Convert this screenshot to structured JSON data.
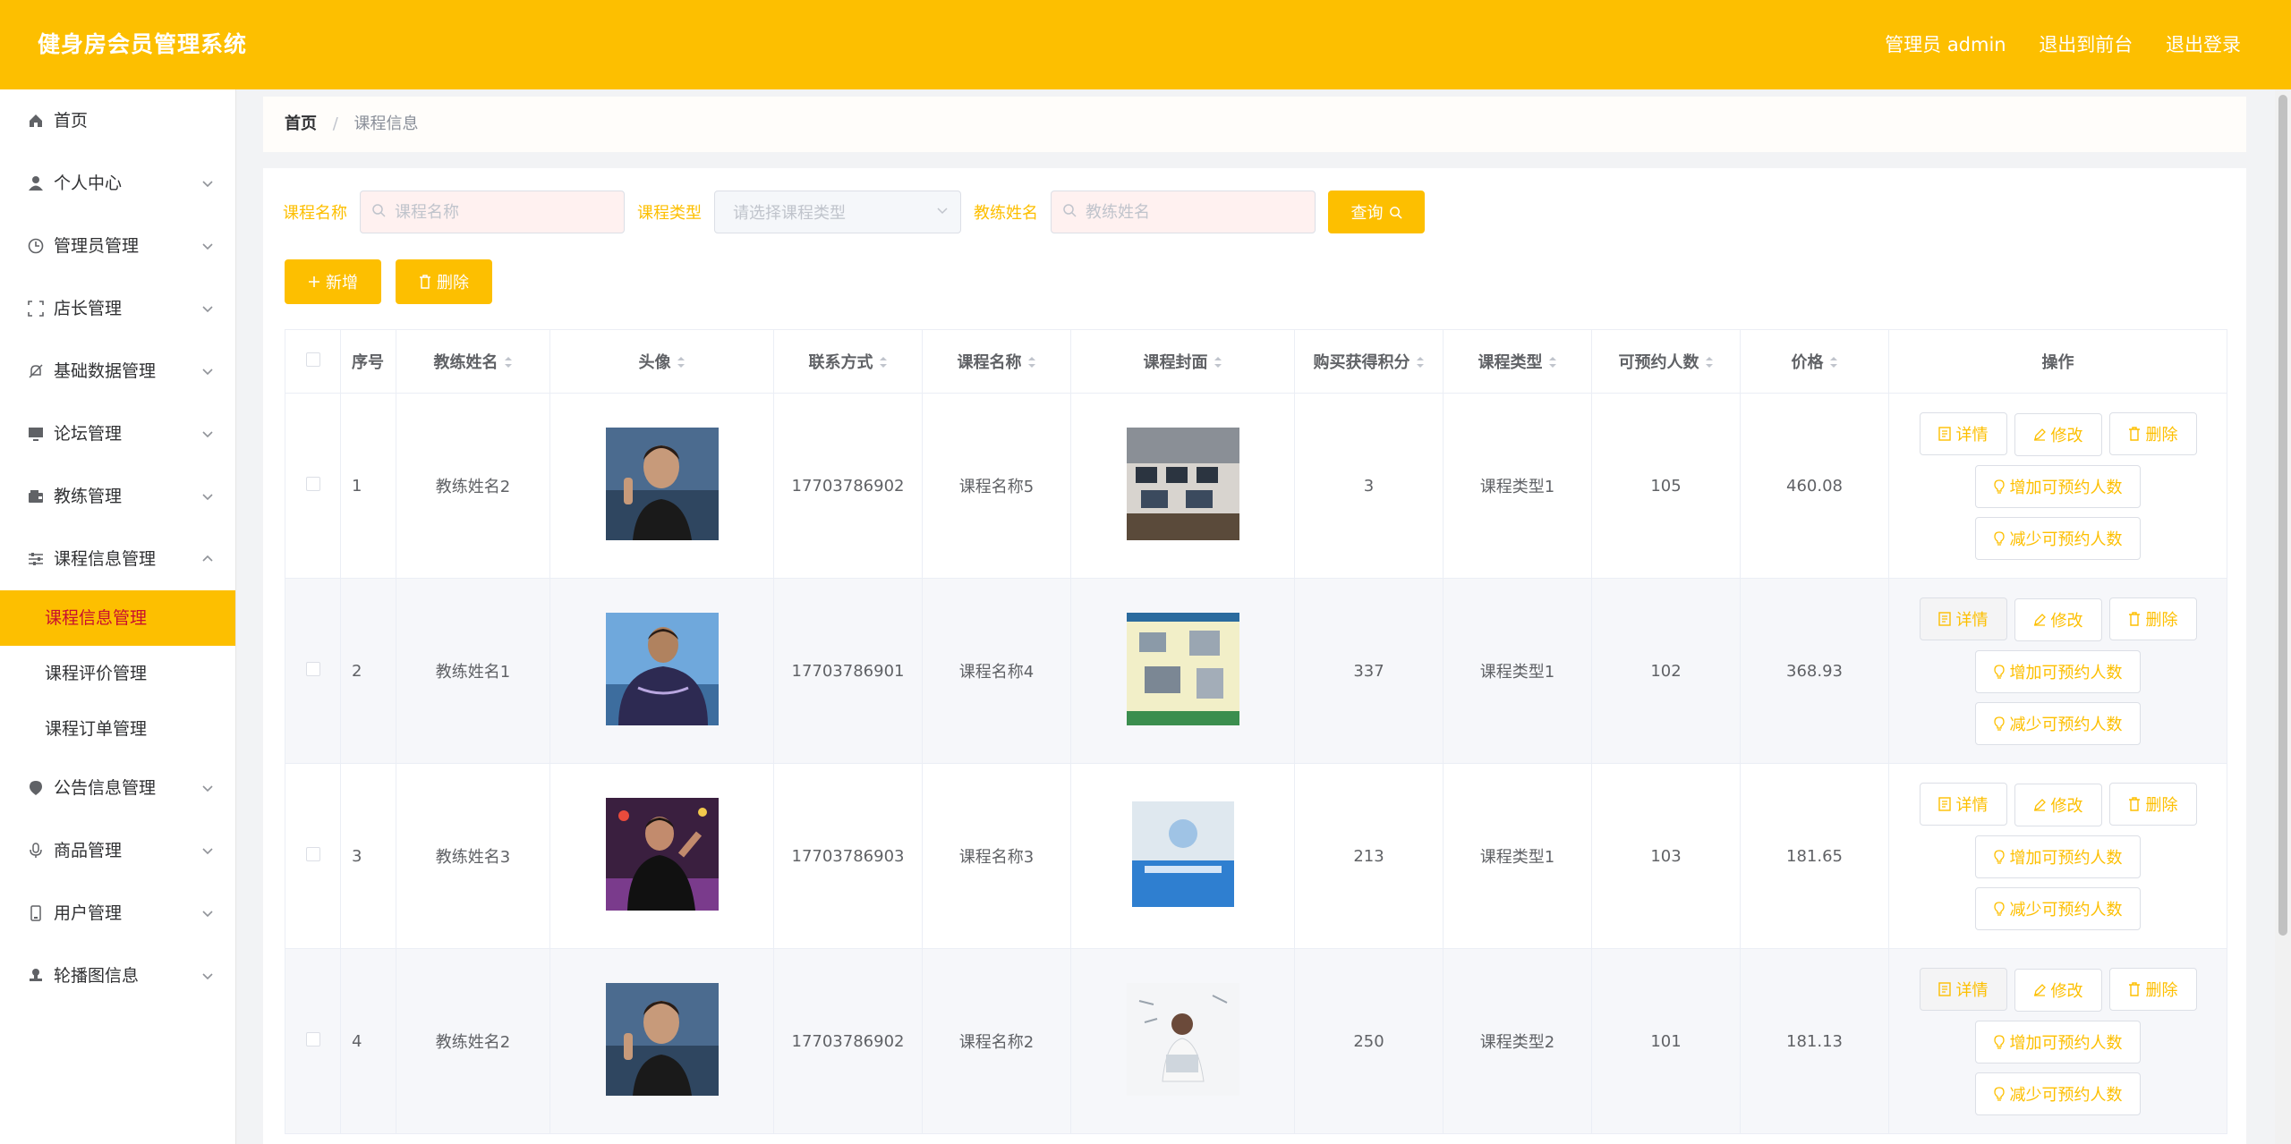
{
  "header": {
    "title": "健身房会员管理系统",
    "admin": "管理员 admin",
    "to_front": "退出到前台",
    "logout": "退出登录"
  },
  "sidebar": {
    "items": [
      {
        "label": "首页",
        "icon": "home-icon"
      },
      {
        "label": "个人中心",
        "icon": "user-icon"
      },
      {
        "label": "管理员管理",
        "icon": "clock-icon"
      },
      {
        "label": "店长管理",
        "icon": "scan-icon"
      },
      {
        "label": "基础数据管理",
        "icon": "bell-off-icon"
      },
      {
        "label": "论坛管理",
        "icon": "monitor-icon"
      },
      {
        "label": "教练管理",
        "icon": "wallet-icon"
      },
      {
        "label": "课程信息管理",
        "icon": "sliders-icon"
      }
    ],
    "subitems": [
      {
        "label": "课程信息管理"
      },
      {
        "label": "课程评价管理"
      },
      {
        "label": "课程订单管理"
      }
    ],
    "items_after": [
      {
        "label": "公告信息管理",
        "icon": "location-icon"
      },
      {
        "label": "商品管理",
        "icon": "mic-icon"
      },
      {
        "label": "用户管理",
        "icon": "phone-icon"
      },
      {
        "label": "轮播图信息",
        "icon": "stamp-icon"
      }
    ]
  },
  "breadcrumb": {
    "home": "首页",
    "current": "课程信息"
  },
  "search": {
    "course_name_label": "课程名称",
    "course_name_placeholder": "课程名称",
    "course_type_label": "课程类型",
    "course_type_placeholder": "请选择课程类型",
    "coach_name_label": "教练姓名",
    "coach_name_placeholder": "教练姓名",
    "query_button": "查询"
  },
  "actions": {
    "add": "新增",
    "delete": "删除"
  },
  "table": {
    "headers": [
      "序号",
      "教练姓名",
      "头像",
      "联系方式",
      "课程名称",
      "课程封面",
      "购买获得积分",
      "课程类型",
      "可预约人数",
      "价格",
      "操作"
    ],
    "rows": [
      {
        "idx": "1",
        "coach": "教练姓名2",
        "phone": "17703786902",
        "course": "课程名称5",
        "points": "3",
        "type": "课程类型1",
        "slots": "105",
        "price": "460.08"
      },
      {
        "idx": "2",
        "coach": "教练姓名1",
        "phone": "17703786901",
        "course": "课程名称4",
        "points": "337",
        "type": "课程类型1",
        "slots": "102",
        "price": "368.93"
      },
      {
        "idx": "3",
        "coach": "教练姓名3",
        "phone": "17703786903",
        "course": "课程名称3",
        "points": "213",
        "type": "课程类型1",
        "slots": "103",
        "price": "181.65"
      },
      {
        "idx": "4",
        "coach": "教练姓名2",
        "phone": "17703786902",
        "course": "课程名称2",
        "points": "250",
        "type": "课程类型2",
        "slots": "101",
        "price": "181.13"
      }
    ],
    "ops": {
      "detail": "详情",
      "edit": "修改",
      "delete": "删除",
      "inc": "增加可预约人数",
      "dec": "减少可预约人数"
    }
  },
  "colors": {
    "accent": "#fdbf00",
    "active_text": "#c8102e"
  }
}
